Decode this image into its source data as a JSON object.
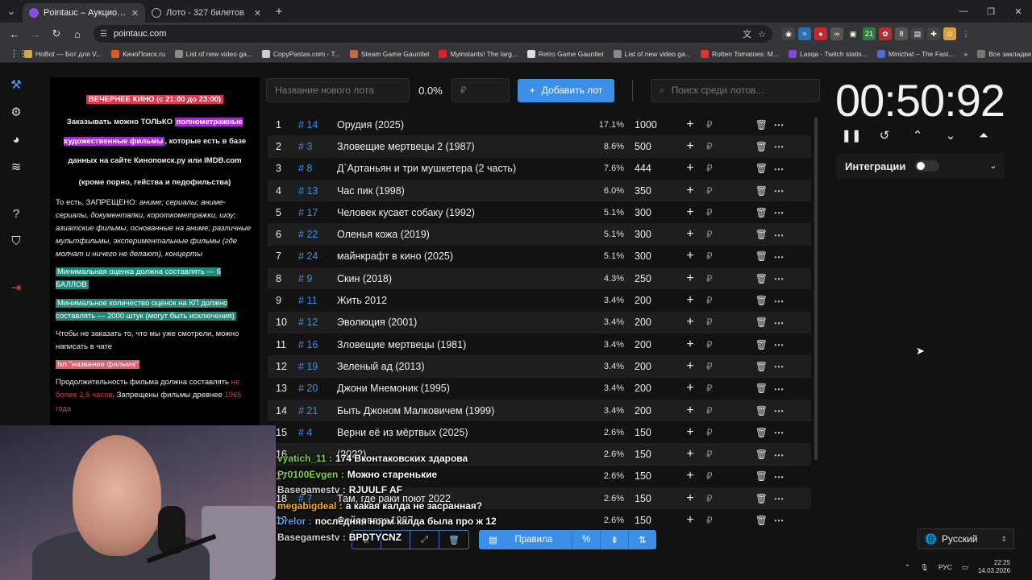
{
  "browser": {
    "tabs": [
      {
        "title": "Pointauc – Аукционы, лотереи",
        "active": true
      },
      {
        "title": "Лото - 327 билетов",
        "active": false
      }
    ],
    "url": "pointauc.com",
    "bookmarks": [
      "HoBot — Бот для V...",
      "КиноПоиск.ru",
      "List of new video ga...",
      "CopyPastas.com - T...",
      "Steam Game Gauntlet",
      "Myinstants! The larg...",
      "Retro Game Gauntlet",
      "List of new video ga...",
      "Rotten Tomatoes: M...",
      "Lasqa - Twitch statis...",
      "Minichat – The Fast..."
    ],
    "all_bookmarks": "Все закладки"
  },
  "rules": {
    "heading": "ВЕЧЕРНЕЕ КИНО (с 21:00 до 23:00)",
    "line1_a": "Заказывать можно ТОЛЬКО ",
    "line1_hl": "полнометражные художественные фильмы",
    "line1_b": ", которые есть в базе данных на сайте Кинопоиск.ру или IMDB.com",
    "line2": "(кроме порно, гейства и педофильства)",
    "forbidden_a": "То есть, ЗАПРЕЩЕНО: ",
    "forbidden_b": "аниме; сериалы; аниме-сериалы, документалки, короткометражки, шоу; азиатские фильмы, основанные на аниме; различные мультфильмы, экспериментальные фильмы (где молчат и ничего не делают), концерты",
    "min_rating": "Минимальная оценка должна составлять — 6 БАЛЛОВ",
    "min_votes": "Минимальное количество оценок на КП должно составлять — 2000 штук (могут быть исключения)",
    "chat_hint": "Чтобы не заказать то, что мы уже смотрели, можно написать в чате",
    "kp_cmd": "!кп \"название фильма\"",
    "duration_a": "Продолжительность фильма должна составлять ",
    "duration_hl": "не более 2,5 часов",
    "duration_b": ". Запрещены фильмы древнее ",
    "duration_hl2": "1965 года"
  },
  "toolbar": {
    "lot_name_placeholder": "Название нового лота",
    "percent": "0.0%",
    "currency_placeholder": "₽",
    "add_button": "Добавить лот",
    "search_placeholder": "Поиск среди лотов..."
  },
  "lots": [
    {
      "n": "1",
      "id": "# 14",
      "title": "Орудия (2025)",
      "pct": "17.1%",
      "amount": "1000"
    },
    {
      "n": "2",
      "id": "# 3",
      "title": "Зловещие мертвецы 2 (1987)",
      "pct": "8.6%",
      "amount": "500"
    },
    {
      "n": "3",
      "id": "# 8",
      "title": "Д`Артаньян и три мушкетера (2 часть)",
      "pct": "7.6%",
      "amount": "444"
    },
    {
      "n": "4",
      "id": "# 13",
      "title": "Час пик (1998)",
      "pct": "6.0%",
      "amount": "350"
    },
    {
      "n": "5",
      "id": "# 17",
      "title": "Человек кусает собаку (1992)",
      "pct": "5.1%",
      "amount": "300"
    },
    {
      "n": "6",
      "id": "# 22",
      "title": "Оленья кожа (2019)",
      "pct": "5.1%",
      "amount": "300"
    },
    {
      "n": "7",
      "id": "# 24",
      "title": "майнкрафт в кино (2025)",
      "pct": "5.1%",
      "amount": "300"
    },
    {
      "n": "8",
      "id": "# 9",
      "title": "Скин (2018)",
      "pct": "4.3%",
      "amount": "250"
    },
    {
      "n": "9",
      "id": "# 11",
      "title": "Жить 2012",
      "pct": "3.4%",
      "amount": "200"
    },
    {
      "n": "10",
      "id": "# 12",
      "title": "Эволюция (2001)",
      "pct": "3.4%",
      "amount": "200"
    },
    {
      "n": "11",
      "id": "# 16",
      "title": "Зловещие мертвецы (1981)",
      "pct": "3.4%",
      "amount": "200"
    },
    {
      "n": "12",
      "id": "# 19",
      "title": "Зеленый ад (2013)",
      "pct": "3.4%",
      "amount": "200"
    },
    {
      "n": "13",
      "id": "# 20",
      "title": "Джони Мнемоник (1995)",
      "pct": "3.4%",
      "amount": "200"
    },
    {
      "n": "14",
      "id": "# 21",
      "title": "Быть Джоном Малковичем (1999)",
      "pct": "3.4%",
      "amount": "200"
    },
    {
      "n": "15",
      "id": "# 4",
      "title": "Верни её из мёртвых (2025)",
      "pct": "2.6%",
      "amount": "150"
    },
    {
      "n": "16",
      "id": "",
      "title": "(2022)",
      "pct": "2.6%",
      "amount": "150"
    },
    {
      "n": "17",
      "id": "",
      "title": "",
      "pct": "2.6%",
      "amount": "150"
    },
    {
      "n": "18",
      "id": "# 7",
      "title": "Там, где раки поют 2022",
      "pct": "2.6%",
      "amount": "150"
    },
    {
      "n": "19",
      "id": "",
      "title": "Фейерверк 1997",
      "pct": "2.6%",
      "amount": "150"
    }
  ],
  "currency_symbol": "₽",
  "bottom": {
    "rules_label": "Правила",
    "percent_label": "%"
  },
  "timer": {
    "value": "00:50:92"
  },
  "integrations": {
    "label": "Интеграции"
  },
  "language": {
    "value": "Русский"
  },
  "chat": [
    {
      "user": "vyatich_11 :",
      "color": "#7cd34a",
      "text": "174 Вконтаковских здарова"
    },
    {
      "user": "Pr0100Evgen :",
      "color": "#7cd34a",
      "text": "Можно старенькие"
    },
    {
      "user": "Basegamestv :",
      "color": "#cfcfcf",
      "text": "RJUULF AF"
    },
    {
      "user": "megabigdeal :",
      "color": "#f2b01e",
      "text": "а какая калда не засранная?"
    },
    {
      "user": "Drelor :",
      "color": "#5a9bff",
      "text": "последняя норм калда была про ж 12"
    },
    {
      "user": "Basegamestv :",
      "color": "#cfcfcf",
      "text": "BPDTYCNZ"
    }
  ],
  "system_tray": {
    "lang": "РУС",
    "time": "22:25",
    "date": "14.03.2026"
  }
}
